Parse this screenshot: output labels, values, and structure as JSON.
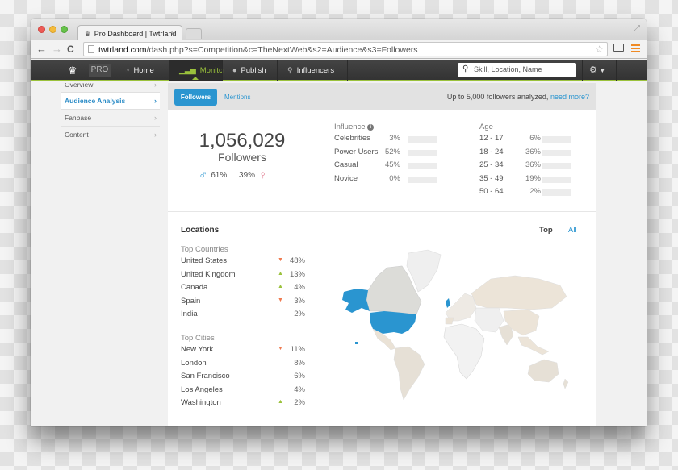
{
  "browser": {
    "tab_title": "Pro Dashboard | Twtrland",
    "tab_icon": "twtrland-crown-icon",
    "url_host": "twtrland.com",
    "url_path": "/dash.php?s=Competition&c=TheNextWeb&s2=Audience&s3=Followers"
  },
  "appnav": {
    "pro_label": "PRO",
    "items": [
      {
        "label": "Home",
        "icon": "dashboard-icon"
      },
      {
        "label": "Monitor",
        "icon": "signal-bars-icon",
        "active": true
      },
      {
        "label": "Publish",
        "icon": "speech-bubble-icon"
      },
      {
        "label": "Influencers",
        "icon": "search-icon"
      }
    ],
    "search_placeholder": "Skill, Location, Name",
    "settings_icon": "gear-icon"
  },
  "sidebar": {
    "items": [
      {
        "label": "Overview"
      },
      {
        "label": "Audience Analysis",
        "active": true
      },
      {
        "label": "Fanbase"
      },
      {
        "label": "Content"
      }
    ]
  },
  "subbar": {
    "tabs": [
      {
        "label": "Followers",
        "active": true
      },
      {
        "label": "Mentions"
      }
    ],
    "analyzed_text": "Up to 5,000 followers analyzed,",
    "need_more_link": "need more?"
  },
  "summary": {
    "followers_count": "1,056,029",
    "followers_label": "Followers",
    "male_pct": "61%",
    "female_pct": "39%"
  },
  "influence": {
    "title": "Influence",
    "rows": [
      {
        "label": "Celebrities",
        "pct": "3%",
        "value": 3
      },
      {
        "label": "Power Users",
        "pct": "52%",
        "value": 52
      },
      {
        "label": "Casual",
        "pct": "45%",
        "value": 45
      },
      {
        "label": "Novice",
        "pct": "0%",
        "value": 0
      }
    ]
  },
  "age": {
    "title": "Age",
    "rows": [
      {
        "label": "12 - 17",
        "pct": "6%",
        "value": 6
      },
      {
        "label": "18 - 24",
        "pct": "36%",
        "value": 36
      },
      {
        "label": "25 - 34",
        "pct": "36%",
        "value": 36
      },
      {
        "label": "35 - 49",
        "pct": "19%",
        "value": 19
      },
      {
        "label": "50 - 64",
        "pct": "2%",
        "value": 2
      }
    ]
  },
  "locations": {
    "title": "Locations",
    "toggle_top": "Top",
    "toggle_all": "All",
    "countries_title": "Top Countries",
    "countries": [
      {
        "name": "United States",
        "pct": "48%",
        "trend": "down"
      },
      {
        "name": "United Kingdom",
        "pct": "13%",
        "trend": "up"
      },
      {
        "name": "Canada",
        "pct": "4%",
        "trend": "up"
      },
      {
        "name": "Spain",
        "pct": "3%",
        "trend": "down"
      },
      {
        "name": "India",
        "pct": "2%",
        "trend": ""
      }
    ],
    "cities_title": "Top Cities",
    "cities": [
      {
        "name": "New York",
        "pct": "11%",
        "trend": "down"
      },
      {
        "name": "London",
        "pct": "8%",
        "trend": ""
      },
      {
        "name": "San Francisco",
        "pct": "6%",
        "trend": ""
      },
      {
        "name": "Los Angeles",
        "pct": "4%",
        "trend": ""
      },
      {
        "name": "Washington",
        "pct": "2%",
        "trend": "up"
      }
    ],
    "map_highlight_color": "#2a95d0"
  },
  "colors": {
    "accent": "#2a95d0",
    "nav_active": "#9bc23c",
    "trend_down": "#ef7a4f",
    "trend_up": "#9bc23c"
  }
}
